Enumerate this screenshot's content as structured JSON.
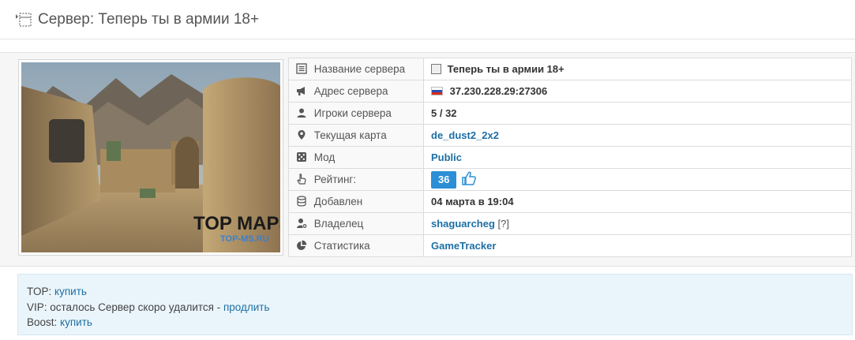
{
  "header": {
    "title": "Сервер: Теперь ты в армии 18+"
  },
  "server": {
    "rows": [
      {
        "label": "Название сервера",
        "value": "Теперь ты в армии 18+",
        "icon": "list-icon"
      },
      {
        "label": "Адрес сервера",
        "value": "37.230.228.29:27306",
        "icon": "megaphone-icon"
      },
      {
        "label": "Игроки сервера",
        "value": "5 / 32",
        "icon": "users-icon"
      },
      {
        "label": "Текущая карта",
        "value": "de_dust2_2x2",
        "icon": "map-marker-icon"
      },
      {
        "label": "Мод",
        "value": "Public",
        "icon": "dice-icon"
      },
      {
        "label": "Рейтинг:",
        "value": "36",
        "icon": "hand-pointer-icon"
      },
      {
        "label": "Добавлен",
        "value": "04 марта в 19:04",
        "icon": "database-icon"
      },
      {
        "label": "Владелец",
        "value": "shaguarcheg",
        "icon": "user-plus-icon"
      },
      {
        "label": "Статистика",
        "value": "GameTracker",
        "icon": "pie-chart-icon"
      }
    ],
    "owner_help": "[?]"
  },
  "screenshot": {
    "overlay_title": "TOP MAPS",
    "overlay_sub": "TOP-MS.RU"
  },
  "promo": {
    "top_label": "TOP:",
    "top_link": "купить",
    "vip_label": "VIP: осталось Сервер скоро удалится -",
    "vip_link": "продлить",
    "boost_label": "Boost:",
    "boost_link": "купить"
  },
  "colors": {
    "link": "#1d6fa5",
    "rating_badge": "#2c8fd6",
    "promo_bg": "#eaf5fb"
  }
}
